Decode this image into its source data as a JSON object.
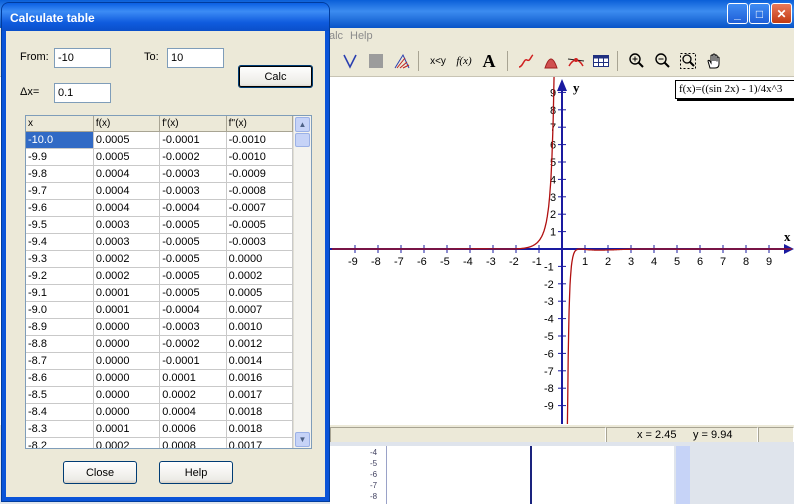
{
  "app": {
    "menu": [
      "alc",
      "Help"
    ],
    "window_buttons": {
      "minimize": "_",
      "maximize": "□",
      "close": "✕"
    },
    "toolbar_text": {
      "xy": "x<y",
      "fx": "f(x)",
      "text": "A"
    },
    "formula": "f(x)=((sin 2x) - 1)/4x^3",
    "axes": {
      "x_label": "x",
      "y_label": "y",
      "x_ticks": [
        "-9",
        "-8",
        "-7",
        "-6",
        "-5",
        "-4",
        "-3",
        "-2",
        "-1",
        "1",
        "2",
        "3",
        "4",
        "5",
        "6",
        "7",
        "8",
        "9"
      ],
      "y_ticks": [
        "9",
        "8",
        "7",
        "6",
        "5",
        "4",
        "3",
        "2",
        "1",
        "-1",
        "-2",
        "-3",
        "-4",
        "-5",
        "-6",
        "-7",
        "-8",
        "-9"
      ]
    },
    "status": {
      "x": "x = 2.45",
      "y": "y = 9.94"
    },
    "lower_ticks": [
      "-4",
      "-5",
      "-6",
      "-7",
      "-8"
    ]
  },
  "dialog": {
    "title": "Calculate table",
    "from_label": "From:",
    "from_value": "-10",
    "to_label": "To:",
    "to_value": "10",
    "dx_label": "Δx=",
    "dx_value": "0.1",
    "calc_label": "Calc",
    "close_label": "Close",
    "help_label": "Help",
    "columns": [
      "x",
      "f(x)",
      "f'(x)",
      "f''(x)"
    ],
    "rows": [
      [
        "-10.0",
        "0.0005",
        "-0.0001",
        "-0.0010"
      ],
      [
        "-9.9",
        "0.0005",
        "-0.0002",
        "-0.0010"
      ],
      [
        "-9.8",
        "0.0004",
        "-0.0003",
        "-0.0009"
      ],
      [
        "-9.7",
        "0.0004",
        "-0.0003",
        "-0.0008"
      ],
      [
        "-9.6",
        "0.0004",
        "-0.0004",
        "-0.0007"
      ],
      [
        "-9.5",
        "0.0003",
        "-0.0005",
        "-0.0005"
      ],
      [
        "-9.4",
        "0.0003",
        "-0.0005",
        "-0.0003"
      ],
      [
        "-9.3",
        "0.0002",
        "-0.0005",
        "0.0000"
      ],
      [
        "-9.2",
        "0.0002",
        "-0.0005",
        "0.0002"
      ],
      [
        "-9.1",
        "0.0001",
        "-0.0005",
        "0.0005"
      ],
      [
        "-9.0",
        "0.0001",
        "-0.0004",
        "0.0007"
      ],
      [
        "-8.9",
        "0.0000",
        "-0.0003",
        "0.0010"
      ],
      [
        "-8.8",
        "0.0000",
        "-0.0002",
        "0.0012"
      ],
      [
        "-8.7",
        "0.0000",
        "-0.0001",
        "0.0014"
      ],
      [
        "-8.6",
        "0.0000",
        "0.0001",
        "0.0016"
      ],
      [
        "-8.5",
        "0.0000",
        "0.0002",
        "0.0017"
      ],
      [
        "-8.4",
        "0.0000",
        "0.0004",
        "0.0018"
      ],
      [
        "-8.3",
        "0.0001",
        "0.0006",
        "0.0018"
      ],
      [
        "-8.2",
        "0.0002",
        "0.0008",
        "0.0017"
      ]
    ]
  }
}
